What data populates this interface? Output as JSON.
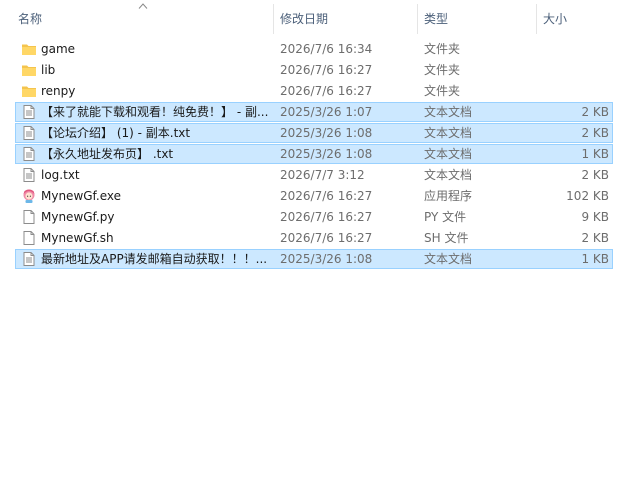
{
  "columns": {
    "name": "名称",
    "date": "修改日期",
    "type": "类型",
    "size": "大小"
  },
  "files": [
    {
      "name": "game",
      "date": "2026/7/6 16:34",
      "type": "文件夹",
      "size": "",
      "icon": "folder-icon",
      "selected": false
    },
    {
      "name": "lib",
      "date": "2026/7/6 16:27",
      "type": "文件夹",
      "size": "",
      "icon": "folder-icon",
      "selected": false
    },
    {
      "name": "renpy",
      "date": "2026/7/6 16:27",
      "type": "文件夹",
      "size": "",
      "icon": "folder-icon",
      "selected": false
    },
    {
      "name": "【来了就能下载和观看！纯免费！】 - 副...",
      "date": "2025/3/26 1:07",
      "type": "文本文档",
      "size": "2 KB",
      "icon": "text-file-icon",
      "selected": true
    },
    {
      "name": "【论坛介绍】 (1) - 副本.txt",
      "date": "2025/3/26 1:08",
      "type": "文本文档",
      "size": "2 KB",
      "icon": "text-file-icon",
      "selected": true
    },
    {
      "name": "【永久地址发布页】 .txt",
      "date": "2025/3/26 1:08",
      "type": "文本文档",
      "size": "1 KB",
      "icon": "text-file-icon",
      "selected": true
    },
    {
      "name": "log.txt",
      "date": "2026/7/7 3:12",
      "type": "文本文档",
      "size": "2 KB",
      "icon": "text-file-icon",
      "selected": false
    },
    {
      "name": "MynewGf.exe",
      "date": "2026/7/6 16:27",
      "type": "应用程序",
      "size": "102 KB",
      "icon": "app-icon",
      "selected": false
    },
    {
      "name": "MynewGf.py",
      "date": "2026/7/6 16:27",
      "type": "PY 文件",
      "size": "9 KB",
      "icon": "blank-file-icon",
      "selected": false
    },
    {
      "name": "MynewGf.sh",
      "date": "2026/7/6 16:27",
      "type": "SH 文件",
      "size": "2 KB",
      "icon": "blank-file-icon",
      "selected": false
    },
    {
      "name": "最新地址及APP请发邮箱自动获取！！！...",
      "date": "2025/3/26 1:08",
      "type": "文本文档",
      "size": "1 KB",
      "icon": "text-file-icon",
      "selected": true
    }
  ],
  "colors": {
    "selection_fill": "#cce8ff",
    "selection_border": "#99d1ff",
    "header_text": "#4c607a",
    "folder": "#f4c44e"
  }
}
